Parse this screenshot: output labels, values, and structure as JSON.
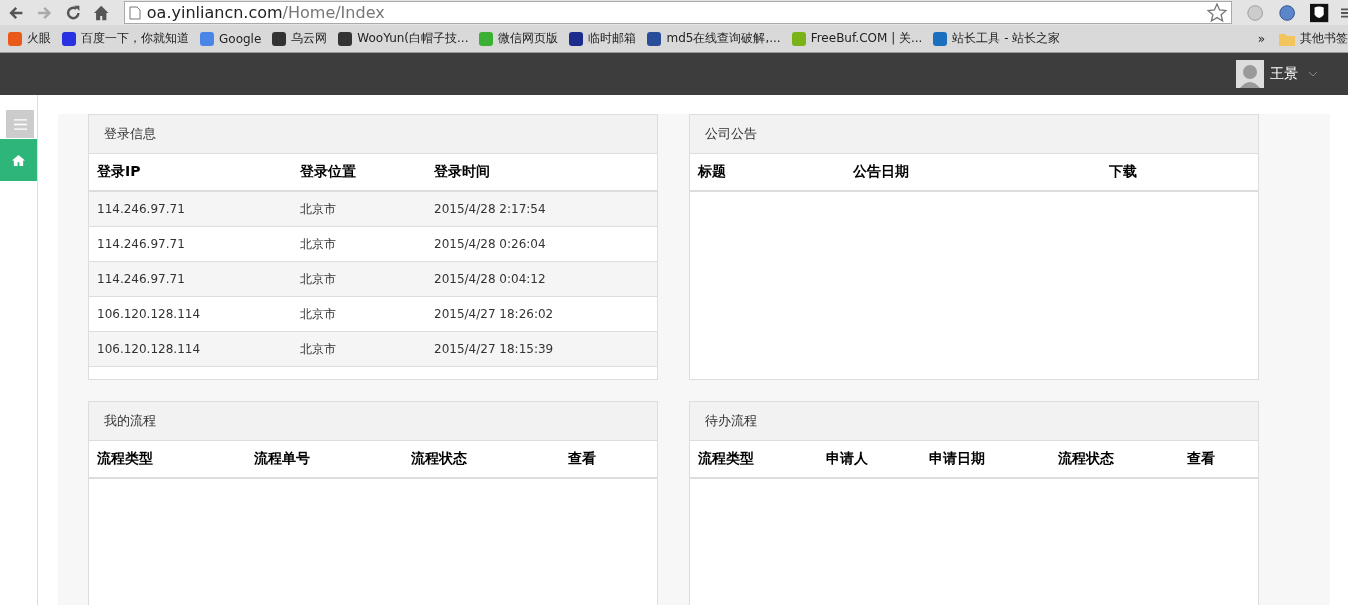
{
  "browser": {
    "url_host": "oa.yinliancn.com",
    "url_path": "/Home/Index",
    "forward_disabled": true,
    "bookmarks": [
      {
        "label": "火眼",
        "color": "#e8591a"
      },
      {
        "label": "百度一下，你就知道",
        "color": "#2932e1"
      },
      {
        "label": "Google",
        "color": "#4a86e8"
      },
      {
        "label": "乌云网",
        "color": "#333333"
      },
      {
        "label": "WooYun(白帽子技...",
        "color": "#333333"
      },
      {
        "label": "微信网页版",
        "color": "#3cb034"
      },
      {
        "label": "临时邮箱",
        "color": "#1c2c8c"
      },
      {
        "label": "md5在线查询破解,...",
        "color": "#2a4d9a"
      },
      {
        "label": "FreeBuf.COM | 关...",
        "color": "#7ab317"
      },
      {
        "label": "站长工具 - 站长之家",
        "color": "#1b6fbf"
      }
    ],
    "overflow": "»",
    "other_bookmarks": "其他书签"
  },
  "header": {
    "user_name": "王景"
  },
  "sidebar": {
    "items": [
      {
        "kind": "menu",
        "selected": false
      },
      {
        "kind": "home",
        "selected": true
      }
    ]
  },
  "panels": [
    {
      "title": "登录信息",
      "columns": [
        "登录IP",
        "登录位置",
        "登录时间"
      ],
      "rows": [
        [
          "114.246.97.71",
          "北京市",
          "2015/4/28 2:17:54"
        ],
        [
          "114.246.97.71",
          "北京市",
          "2015/4/28 0:26:04"
        ],
        [
          "114.246.97.71",
          "北京市",
          "2015/4/28 0:04:12"
        ],
        [
          "106.120.128.114",
          "北京市",
          "2015/4/27 18:26:02"
        ],
        [
          "106.120.128.114",
          "北京市",
          "2015/4/27 18:15:39"
        ]
      ]
    },
    {
      "title": "公司公告",
      "columns": [
        "标题",
        "公告日期",
        "下载"
      ]
    },
    {
      "title": "我的流程",
      "columns": [
        "流程类型",
        "流程单号",
        "流程状态",
        "查看"
      ]
    },
    {
      "title": "待办流程",
      "columns": [
        "流程类型",
        "申请人",
        "申请日期",
        "流程状态",
        "查看"
      ]
    }
  ]
}
